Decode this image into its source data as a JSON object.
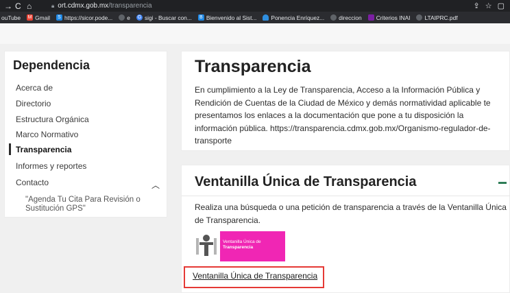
{
  "browser": {
    "url_host": "ort.cdmx.gob.mx",
    "url_path": "/transparencia",
    "bookmarks": [
      {
        "label": "ouTube",
        "icon": "youtube-icon",
        "color": "#ff0000"
      },
      {
        "label": "Gmail",
        "icon": "gmail-icon",
        "color": "#ea4335"
      },
      {
        "label": "https://sicor.pode...",
        "icon": "sicor-icon",
        "color": "#1e88e5"
      },
      {
        "label": "e",
        "icon": "globe-icon",
        "color": "#9aa0a6"
      },
      {
        "label": "sigi - Buscar con...",
        "icon": "google-icon",
        "color": "#4285f4"
      },
      {
        "label": "Bienvenido al Sist...",
        "icon": "sistema-icon",
        "color": "#1e88e5"
      },
      {
        "label": "Ponencia Enríquez...",
        "icon": "cloud-icon",
        "color": "#2f8fe0"
      },
      {
        "label": "direccion",
        "icon": "globe-icon",
        "color": "#9aa0a6"
      },
      {
        "label": "Criterios INAI",
        "icon": "inai-icon",
        "color": "#7b1fa2"
      },
      {
        "label": "LTAIPRC.pdf",
        "icon": "globe-icon",
        "color": "#9aa0a6"
      }
    ]
  },
  "sidebar": {
    "title": "Dependencia",
    "items": [
      {
        "label": "Acerca de"
      },
      {
        "label": "Directorio"
      },
      {
        "label": "Estructura Orgánica"
      },
      {
        "label": "Marco Normativo"
      },
      {
        "label": "Transparencia"
      },
      {
        "label": "Informes y reportes"
      },
      {
        "label": "Contacto"
      }
    ],
    "sub_item": "\"Agenda Tu Cita Para Revisión o Sustitución GPS\""
  },
  "main": {
    "title": "Transparencia",
    "body": "En cumplimiento a la Ley de Transparencia, Acceso a la Información Pública y Rendición de Cuentas de la Ciudad de México y demás normatividad aplicable te presentamos los enlaces a la documentación que pone a tu disposición la información pública. https://transparencia.cdmx.gob.mx/Organismo-regulador-de-transporte",
    "section": {
      "title": "Ventanilla Única de Transparencia",
      "body": "Realiza una búsqueda o una petición de transparencia a través de la Ventanilla Única de Transparencia.",
      "logo_line1": "Ventanilla Única de",
      "logo_line2": "Transparencia",
      "link_label": "Ventanilla Única de Transparencia"
    }
  },
  "colors": {
    "accent_green": "#2e7d57",
    "logo_pink": "#f026b4",
    "highlight_red": "#e53935"
  }
}
